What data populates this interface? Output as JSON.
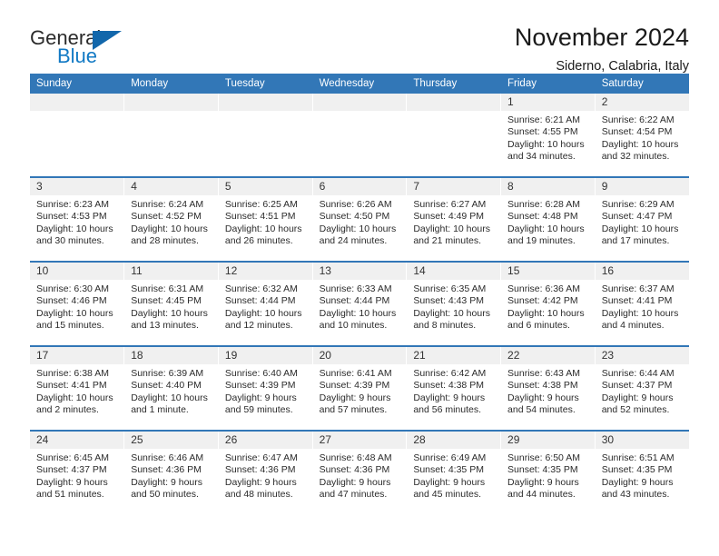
{
  "logo": {
    "word1": "General",
    "word2": "Blue",
    "triangle_color": "#1267ab",
    "blue_color": "#1179c4"
  },
  "header": {
    "title": "November 2024",
    "location": "Siderno, Calabria, Italy",
    "accent_color": "#3277b7",
    "daynum_bg": "#f0f0f0"
  },
  "weekday_headers": [
    "Sunday",
    "Monday",
    "Tuesday",
    "Wednesday",
    "Thursday",
    "Friday",
    "Saturday"
  ],
  "labels": {
    "sunrise_prefix": "Sunrise:",
    "sunset_prefix": "Sunset:",
    "daylight_prefix": "Daylight:"
  },
  "weeks": [
    [
      {
        "day": "",
        "empty": true
      },
      {
        "day": "",
        "empty": true
      },
      {
        "day": "",
        "empty": true
      },
      {
        "day": "",
        "empty": true
      },
      {
        "day": "",
        "empty": true
      },
      {
        "day": "1",
        "sunrise": "Sunrise: 6:21 AM",
        "sunset": "Sunset: 4:55 PM",
        "daylight_line1": "Daylight: 10 hours",
        "daylight_line2": "and 34 minutes."
      },
      {
        "day": "2",
        "sunrise": "Sunrise: 6:22 AM",
        "sunset": "Sunset: 4:54 PM",
        "daylight_line1": "Daylight: 10 hours",
        "daylight_line2": "and 32 minutes."
      }
    ],
    [
      {
        "day": "3",
        "sunrise": "Sunrise: 6:23 AM",
        "sunset": "Sunset: 4:53 PM",
        "daylight_line1": "Daylight: 10 hours",
        "daylight_line2": "and 30 minutes."
      },
      {
        "day": "4",
        "sunrise": "Sunrise: 6:24 AM",
        "sunset": "Sunset: 4:52 PM",
        "daylight_line1": "Daylight: 10 hours",
        "daylight_line2": "and 28 minutes."
      },
      {
        "day": "5",
        "sunrise": "Sunrise: 6:25 AM",
        "sunset": "Sunset: 4:51 PM",
        "daylight_line1": "Daylight: 10 hours",
        "daylight_line2": "and 26 minutes."
      },
      {
        "day": "6",
        "sunrise": "Sunrise: 6:26 AM",
        "sunset": "Sunset: 4:50 PM",
        "daylight_line1": "Daylight: 10 hours",
        "daylight_line2": "and 24 minutes."
      },
      {
        "day": "7",
        "sunrise": "Sunrise: 6:27 AM",
        "sunset": "Sunset: 4:49 PM",
        "daylight_line1": "Daylight: 10 hours",
        "daylight_line2": "and 21 minutes."
      },
      {
        "day": "8",
        "sunrise": "Sunrise: 6:28 AM",
        "sunset": "Sunset: 4:48 PM",
        "daylight_line1": "Daylight: 10 hours",
        "daylight_line2": "and 19 minutes."
      },
      {
        "day": "9",
        "sunrise": "Sunrise: 6:29 AM",
        "sunset": "Sunset: 4:47 PM",
        "daylight_line1": "Daylight: 10 hours",
        "daylight_line2": "and 17 minutes."
      }
    ],
    [
      {
        "day": "10",
        "sunrise": "Sunrise: 6:30 AM",
        "sunset": "Sunset: 4:46 PM",
        "daylight_line1": "Daylight: 10 hours",
        "daylight_line2": "and 15 minutes."
      },
      {
        "day": "11",
        "sunrise": "Sunrise: 6:31 AM",
        "sunset": "Sunset: 4:45 PM",
        "daylight_line1": "Daylight: 10 hours",
        "daylight_line2": "and 13 minutes."
      },
      {
        "day": "12",
        "sunrise": "Sunrise: 6:32 AM",
        "sunset": "Sunset: 4:44 PM",
        "daylight_line1": "Daylight: 10 hours",
        "daylight_line2": "and 12 minutes."
      },
      {
        "day": "13",
        "sunrise": "Sunrise: 6:33 AM",
        "sunset": "Sunset: 4:44 PM",
        "daylight_line1": "Daylight: 10 hours",
        "daylight_line2": "and 10 minutes."
      },
      {
        "day": "14",
        "sunrise": "Sunrise: 6:35 AM",
        "sunset": "Sunset: 4:43 PM",
        "daylight_line1": "Daylight: 10 hours",
        "daylight_line2": "and 8 minutes."
      },
      {
        "day": "15",
        "sunrise": "Sunrise: 6:36 AM",
        "sunset": "Sunset: 4:42 PM",
        "daylight_line1": "Daylight: 10 hours",
        "daylight_line2": "and 6 minutes."
      },
      {
        "day": "16",
        "sunrise": "Sunrise: 6:37 AM",
        "sunset": "Sunset: 4:41 PM",
        "daylight_line1": "Daylight: 10 hours",
        "daylight_line2": "and 4 minutes."
      }
    ],
    [
      {
        "day": "17",
        "sunrise": "Sunrise: 6:38 AM",
        "sunset": "Sunset: 4:41 PM",
        "daylight_line1": "Daylight: 10 hours",
        "daylight_line2": "and 2 minutes."
      },
      {
        "day": "18",
        "sunrise": "Sunrise: 6:39 AM",
        "sunset": "Sunset: 4:40 PM",
        "daylight_line1": "Daylight: 10 hours",
        "daylight_line2": "and 1 minute."
      },
      {
        "day": "19",
        "sunrise": "Sunrise: 6:40 AM",
        "sunset": "Sunset: 4:39 PM",
        "daylight_line1": "Daylight: 9 hours",
        "daylight_line2": "and 59 minutes."
      },
      {
        "day": "20",
        "sunrise": "Sunrise: 6:41 AM",
        "sunset": "Sunset: 4:39 PM",
        "daylight_line1": "Daylight: 9 hours",
        "daylight_line2": "and 57 minutes."
      },
      {
        "day": "21",
        "sunrise": "Sunrise: 6:42 AM",
        "sunset": "Sunset: 4:38 PM",
        "daylight_line1": "Daylight: 9 hours",
        "daylight_line2": "and 56 minutes."
      },
      {
        "day": "22",
        "sunrise": "Sunrise: 6:43 AM",
        "sunset": "Sunset: 4:38 PM",
        "daylight_line1": "Daylight: 9 hours",
        "daylight_line2": "and 54 minutes."
      },
      {
        "day": "23",
        "sunrise": "Sunrise: 6:44 AM",
        "sunset": "Sunset: 4:37 PM",
        "daylight_line1": "Daylight: 9 hours",
        "daylight_line2": "and 52 minutes."
      }
    ],
    [
      {
        "day": "24",
        "sunrise": "Sunrise: 6:45 AM",
        "sunset": "Sunset: 4:37 PM",
        "daylight_line1": "Daylight: 9 hours",
        "daylight_line2": "and 51 minutes."
      },
      {
        "day": "25",
        "sunrise": "Sunrise: 6:46 AM",
        "sunset": "Sunset: 4:36 PM",
        "daylight_line1": "Daylight: 9 hours",
        "daylight_line2": "and 50 minutes."
      },
      {
        "day": "26",
        "sunrise": "Sunrise: 6:47 AM",
        "sunset": "Sunset: 4:36 PM",
        "daylight_line1": "Daylight: 9 hours",
        "daylight_line2": "and 48 minutes."
      },
      {
        "day": "27",
        "sunrise": "Sunrise: 6:48 AM",
        "sunset": "Sunset: 4:36 PM",
        "daylight_line1": "Daylight: 9 hours",
        "daylight_line2": "and 47 minutes."
      },
      {
        "day": "28",
        "sunrise": "Sunrise: 6:49 AM",
        "sunset": "Sunset: 4:35 PM",
        "daylight_line1": "Daylight: 9 hours",
        "daylight_line2": "and 45 minutes."
      },
      {
        "day": "29",
        "sunrise": "Sunrise: 6:50 AM",
        "sunset": "Sunset: 4:35 PM",
        "daylight_line1": "Daylight: 9 hours",
        "daylight_line2": "and 44 minutes."
      },
      {
        "day": "30",
        "sunrise": "Sunrise: 6:51 AM",
        "sunset": "Sunset: 4:35 PM",
        "daylight_line1": "Daylight: 9 hours",
        "daylight_line2": "and 43 minutes."
      }
    ]
  ]
}
